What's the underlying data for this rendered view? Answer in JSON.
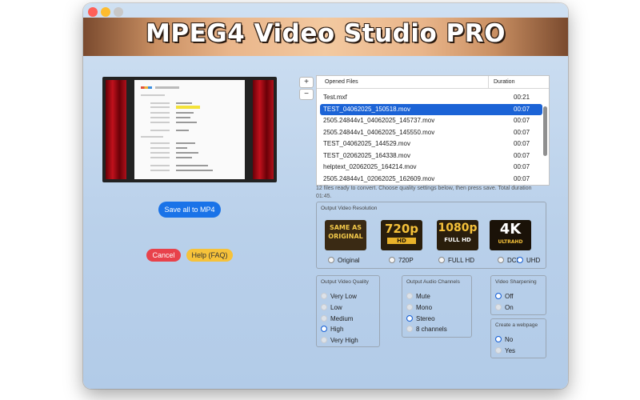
{
  "app_title": "MPEG4 Video Studio PRO",
  "buttons": {
    "add": "+",
    "remove": "−",
    "save": "Save all to MP4",
    "cancel": "Cancel",
    "help": "Help (FAQ)"
  },
  "file_table": {
    "columns": [
      "Opened Files",
      "Duration"
    ],
    "rows": [
      {
        "name": "Test.mxf",
        "duration": "00:21",
        "selected": false
      },
      {
        "name": "TEST_04062025_150518.mov",
        "duration": "00:07",
        "selected": true
      },
      {
        "name": "2505.24844v1_04062025_145737.mov",
        "duration": "00:07",
        "selected": false
      },
      {
        "name": "2505.24844v1_04062025_145550.mov",
        "duration": "00:07",
        "selected": false
      },
      {
        "name": "TEST_04062025_144529.mov",
        "duration": "00:07",
        "selected": false
      },
      {
        "name": "TEST_02062025_164338.mov",
        "duration": "00:07",
        "selected": false
      },
      {
        "name": "helptext_02062025_164214.mov",
        "duration": "00:07",
        "selected": false
      },
      {
        "name": "2505.24844v1_02062025_162609.mov",
        "duration": "00:07",
        "selected": false
      }
    ]
  },
  "status_text": "12 files ready to convert. Choose quality settings below, then press save. Total duration 01:45.",
  "resolution": {
    "label": "Output Video Resolution",
    "badges": {
      "b1a": "SAME AS",
      "b1b": "ORIGINAL",
      "b2a": "720p",
      "b2b": "HD",
      "b3a": "1080p",
      "b3b": "FULL HD",
      "b4a": "4K",
      "b4b": "ULTRAHD"
    },
    "options": [
      "Original",
      "720P",
      "FULL HD",
      "DCI",
      "UHD"
    ],
    "selected": "UHD"
  },
  "quality": {
    "label": "Output Video Quality",
    "options": [
      "Very Low",
      "Low",
      "Medium",
      "High",
      "Very High"
    ],
    "selected": "High"
  },
  "audio": {
    "label": "Output Audio Channels",
    "options": [
      "Mute",
      "Mono",
      "Stereo",
      "8 channels"
    ],
    "selected": "Stereo"
  },
  "sharpening": {
    "label": "Video Sharpening",
    "options": [
      "Off",
      "On"
    ],
    "selected": "Off"
  },
  "webpage": {
    "label": "Create a webpage",
    "options": [
      "No",
      "Yes"
    ],
    "selected": "No"
  },
  "colors": {
    "accent": "#1b63d6",
    "save": "#1a73e8",
    "cancel": "#e8424b",
    "help": "#f6c23a"
  }
}
